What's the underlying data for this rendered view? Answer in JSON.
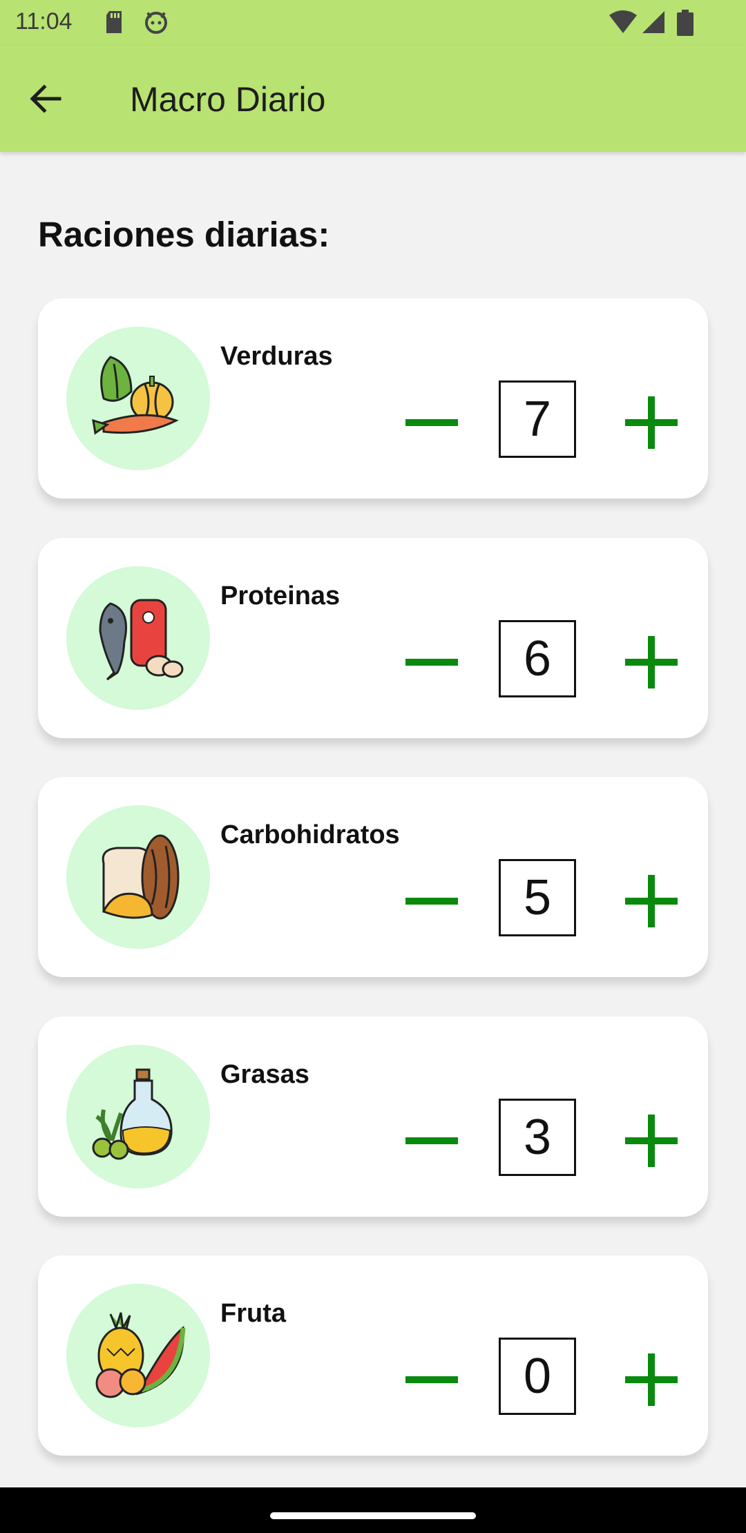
{
  "status_bar": {
    "time": "11:04",
    "left_icons": [
      "sd-card-icon",
      "android-icon"
    ],
    "right_icons": [
      "wifi-icon",
      "signal-icon",
      "battery-icon"
    ]
  },
  "app_bar": {
    "title": "Macro Diario",
    "back_icon": "arrow-left-icon",
    "color": "#b8e272"
  },
  "section_title": "Raciones diarias:",
  "accent_color": "#098a0e",
  "icon_bg_color": "#d4fad8",
  "items": [
    {
      "label": "Verduras",
      "count": "7",
      "icon": "vegetables-icon"
    },
    {
      "label": "Proteinas",
      "count": "6",
      "icon": "proteins-icon"
    },
    {
      "label": "Carbohidratos",
      "count": "5",
      "icon": "carbs-icon"
    },
    {
      "label": "Grasas",
      "count": "3",
      "icon": "fats-icon"
    },
    {
      "label": "Fruta",
      "count": "0",
      "icon": "fruit-icon"
    }
  ]
}
